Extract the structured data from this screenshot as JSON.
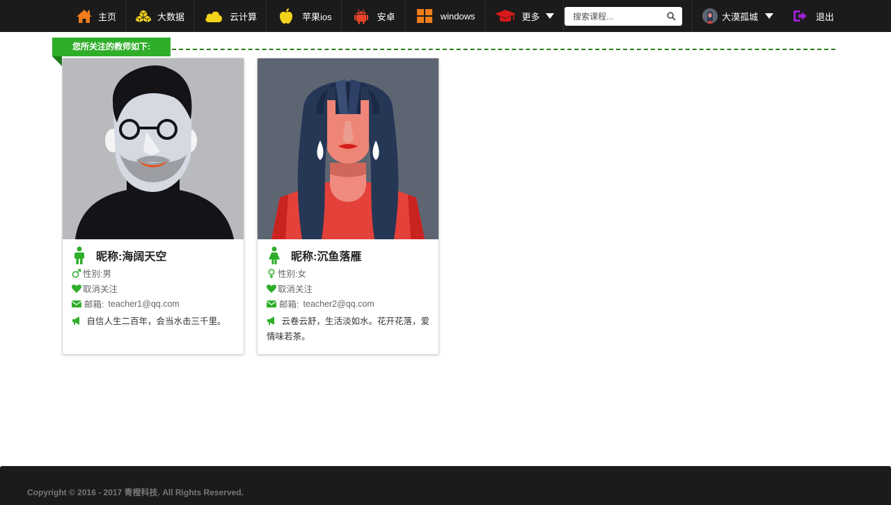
{
  "nav": {
    "items": [
      {
        "label": "主页",
        "icon": "home-icon",
        "color": "#f07c1a"
      },
      {
        "label": "大数据",
        "icon": "cubes-icon",
        "color": "#f3d21a"
      },
      {
        "label": "云计算",
        "icon": "cloud-icon",
        "color": "#f3d21a"
      },
      {
        "label": "苹果ios",
        "icon": "apple-icon",
        "color": "#f3d21a"
      },
      {
        "label": "安卓",
        "icon": "android-icon",
        "color": "#e8452a"
      },
      {
        "label": "windows",
        "icon": "windows-icon",
        "color": "#f07c1a"
      },
      {
        "label": "更多",
        "icon": "graduation-cap-icon",
        "color": "#d7191b"
      }
    ],
    "search_placeholder": "搜索课程...",
    "user_name": "大漠孤城",
    "logout_label": "退出",
    "logout_color": "#9b1fd1"
  },
  "section": {
    "title": "您所关注的教师如下:",
    "accent": "#2fae2a"
  },
  "teachers": [
    {
      "nick_label": "昵称:",
      "nickname": "海阔天空",
      "gender_label": "性别:",
      "gender": "男",
      "unfollow_label": "取消关注",
      "email_label": "邮箱:",
      "email": "teacher1@qq.com",
      "bio": "自信人生二百年，会当水击三千里。"
    },
    {
      "nick_label": "昵称:",
      "nickname": "沉鱼落雁",
      "gender_label": "性别:",
      "gender": "女",
      "unfollow_label": "取消关注",
      "email_label": "邮箱:",
      "email": "teacher2@qq.com",
      "bio": "云卷云舒，生活淡如水。花开花落，爱情味若茶。"
    }
  ],
  "footer": {
    "copyright": "Copyright © 2016 - 2017 青橙科技. All Rights Reserved."
  }
}
